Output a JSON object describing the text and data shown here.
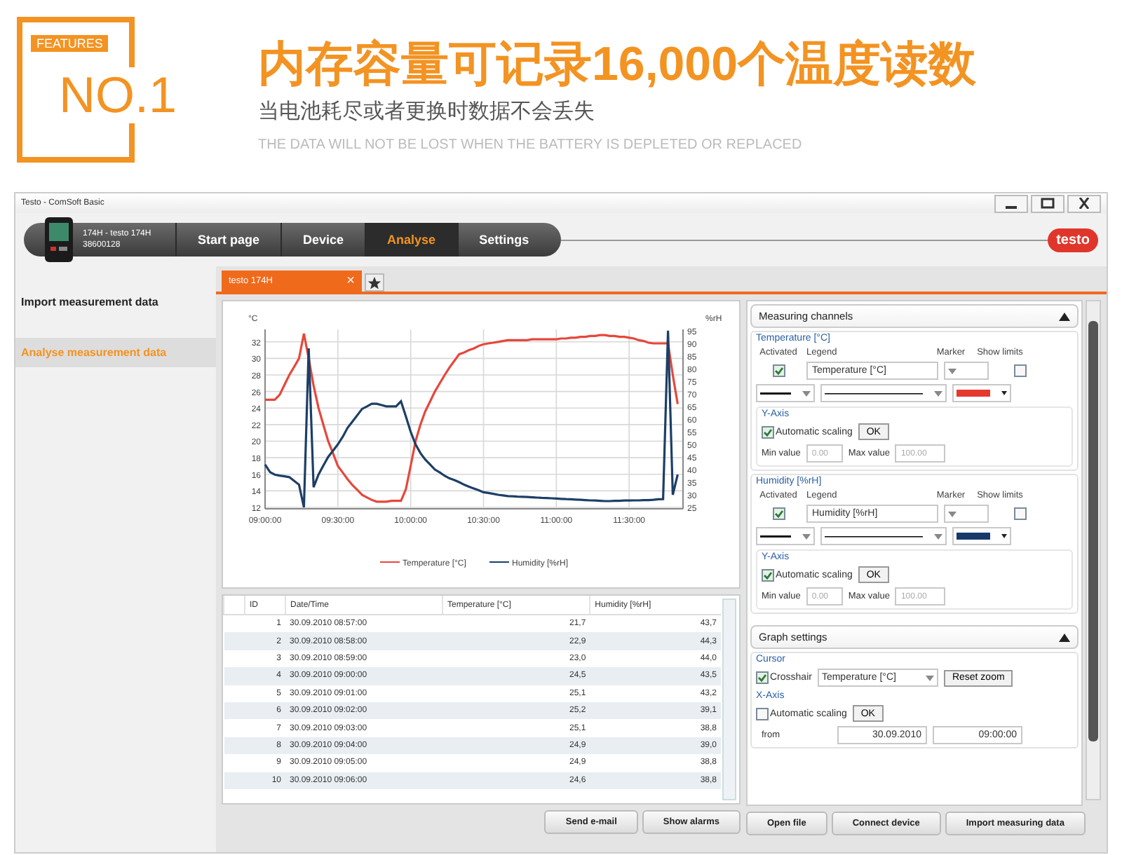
{
  "header": {
    "badge": "FEATURES",
    "rank": "NO.1",
    "title": "内存容量可记录16,000个温度读数",
    "subtitle": "当电池耗尽或者更换时数据不会丢失",
    "caption": "THE DATA WILL NOT BE LOST WHEN THE BATTERY IS DEPLETED OR REPLACED"
  },
  "window": {
    "title": "Testo - ComSoft Basic"
  },
  "device": {
    "name": "174H - testo 174H",
    "serial": "38600128"
  },
  "nav_tabs": [
    {
      "label": "Start page",
      "selected": false
    },
    {
      "label": "Device",
      "selected": false
    },
    {
      "label": "Analyse",
      "selected": true
    },
    {
      "label": "Settings",
      "selected": false
    }
  ],
  "logo": "testo",
  "sidebar": {
    "items": [
      {
        "label": "Import measurement data",
        "selected": false
      },
      {
        "label": "Analyse measurement data",
        "selected": true
      }
    ]
  },
  "doc_tabs": [
    {
      "label": "testo 174H",
      "close": "×",
      "selected": true
    }
  ],
  "chart_data": {
    "type": "line",
    "ylabel": "°C",
    "y2label": "%rH",
    "categories": [
      "09:00:00",
      null,
      null,
      null,
      null,
      null,
      null,
      null,
      null,
      null,
      null,
      null,
      null,
      null,
      null,
      "09:30:00",
      null,
      null,
      null,
      null,
      null,
      null,
      null,
      null,
      null,
      null,
      null,
      null,
      null,
      null,
      "10:00:00",
      null,
      null,
      null,
      null,
      null,
      null,
      null,
      null,
      null,
      null,
      null,
      null,
      null,
      null,
      "10:30:00",
      null,
      null,
      null,
      null,
      null,
      null,
      null,
      null,
      null,
      null,
      null,
      null,
      null,
      null,
      "11:00:00",
      null,
      null,
      null,
      null,
      null,
      null,
      null,
      null,
      null,
      null,
      null,
      null,
      null,
      null,
      "11:30:00",
      null,
      null,
      null,
      null,
      null,
      null,
      null,
      null,
      null,
      null
    ],
    "ylim": [
      12,
      33.5
    ],
    "y2lim": [
      25,
      95.5
    ],
    "grid": true,
    "legend": "bottom",
    "yticks": [
      12,
      14,
      16,
      18,
      20,
      22,
      24,
      26,
      28,
      30,
      32
    ],
    "y2ticks": [
      25,
      30,
      35,
      40,
      45,
      50,
      55,
      60,
      65,
      70,
      75,
      80,
      85,
      90,
      95
    ],
    "series": [
      {
        "name": "Temperature [°C]",
        "color": "#e5483c",
        "values": [
          25,
          25,
          25,
          25.6,
          26.8,
          28,
          29,
          30,
          33,
          30,
          26.7,
          24,
          22,
          20,
          18.5,
          17,
          16.2,
          15.4,
          14.7,
          14.1,
          13.5,
          13.2,
          12.9,
          12.7,
          12.7,
          12.7,
          12.8,
          12.8,
          12.8,
          14.2,
          17,
          20,
          22,
          23.6,
          24.8,
          26,
          27,
          28,
          28.9,
          29.7,
          30.5,
          30.7,
          31,
          31.2,
          31.5,
          31.7,
          31.8,
          31.9,
          32,
          32.1,
          32.2,
          32.2,
          32.2,
          32.2,
          32.2,
          32.3,
          32.3,
          32.3,
          32.3,
          32.3,
          32.3,
          32.4,
          32.4,
          32.5,
          32.5,
          32.6,
          32.6,
          32.7,
          32.7,
          32.8,
          32.8,
          32.7,
          32.7,
          32.6,
          32.6,
          32.5,
          32.4,
          32.2,
          32.1,
          31.9,
          31.8,
          31.8,
          31.8,
          31.8,
          28,
          24.5
        ]
      },
      {
        "name": "Humidity [%rH]",
        "color": "#1d3f66",
        "axis": "y2",
        "values": [
          42,
          39,
          38,
          37.6,
          37.3,
          37,
          35.5,
          34,
          25,
          88,
          33,
          38,
          41.5,
          45,
          47.5,
          50,
          53,
          56.5,
          59,
          61.5,
          64,
          65,
          66,
          66,
          65.5,
          65,
          65,
          65,
          67,
          61,
          55,
          50,
          46.5,
          44,
          42,
          40,
          38.8,
          37.5,
          36.5,
          35.8,
          35,
          34,
          33.2,
          32.5,
          31.8,
          31,
          30.7,
          30.4,
          30,
          29.8,
          29.5,
          29.4,
          29.3,
          29.2,
          29.1,
          29,
          28.9,
          28.8,
          28.7,
          28.6,
          28.5,
          28.4,
          28.3,
          28.2,
          28.1,
          28,
          27.9,
          27.8,
          27.7,
          27.6,
          27.5,
          27.5,
          27.6,
          27.6,
          27.7,
          27.7,
          27.8,
          27.8,
          27.9,
          27.9,
          28,
          28.2,
          28.3,
          95,
          30,
          38
        ]
      }
    ]
  },
  "table": {
    "columns": [
      "ID",
      "Date/Time",
      "Temperature [°C]",
      "Humidity [%rH]"
    ],
    "rows": [
      [
        "1",
        "30.09.2010 08:57:00",
        "21,7",
        "43,7"
      ],
      [
        "2",
        "30.09.2010 08:58:00",
        "22,9",
        "44,3"
      ],
      [
        "3",
        "30.09.2010 08:59:00",
        "23,0",
        "44,0"
      ],
      [
        "4",
        "30.09.2010 09:00:00",
        "24,5",
        "43,5"
      ],
      [
        "5",
        "30.09.2010 09:01:00",
        "25,1",
        "43,2"
      ],
      [
        "6",
        "30.09.2010 09:02:00",
        "25,2",
        "39,1"
      ],
      [
        "7",
        "30.09.2010 09:03:00",
        "25,1",
        "38,8"
      ],
      [
        "8",
        "30.09.2010 09:04:00",
        "24,9",
        "39,0"
      ],
      [
        "9",
        "30.09.2010 09:05:00",
        "24,9",
        "38,8"
      ],
      [
        "10",
        "30.09.2010 09:06:00",
        "24,6",
        "38,8"
      ]
    ]
  },
  "left_buttons": [
    "Send e-mail",
    "Show alarms"
  ],
  "right_buttons": [
    "Open file",
    "Connect device",
    "Import measuring data"
  ],
  "measuring_channels": {
    "title": "Measuring channels",
    "channels": [
      {
        "name": "Temperature [°C]",
        "column_labels": [
          "Activated",
          "Legend",
          "Marker",
          "Show limits"
        ],
        "activated": true,
        "legend": "Temperature [°C]",
        "show_limits": false,
        "color": "#e5392e",
        "y_axis": {
          "title": "Y-Axis",
          "auto_label": "Automatic scaling",
          "automatic_scaling": true,
          "ok": "OK",
          "min_label": "Min value",
          "min": "0.00",
          "max_label": "Max value",
          "max": "100.00"
        }
      },
      {
        "name": "Humidity [%rH]",
        "column_labels": [
          "Activated",
          "Legend",
          "Marker",
          "Show limits"
        ],
        "activated": true,
        "legend": "Humidity [%rH]",
        "show_limits": false,
        "color": "#173a6b",
        "y_axis": {
          "title": "Y-Axis",
          "auto_label": "Automatic scaling",
          "automatic_scaling": true,
          "ok": "OK",
          "min_label": "Min value",
          "min": "0.00",
          "max_label": "Max value",
          "max": "100.00"
        }
      }
    ]
  },
  "graph_settings": {
    "title": "Graph settings",
    "cursor": {
      "title": "Cursor",
      "crosshair_label": "Crosshair",
      "crosshair": true,
      "channel": "Temperature [°C]",
      "reset": "Reset zoom"
    },
    "x_axis": {
      "title": "X-Axis",
      "auto_label": "Automatic scaling",
      "automatic_scaling": false,
      "ok": "OK",
      "from_label": "from",
      "from_date": "30.09.2010",
      "from_time": "09:00:00"
    }
  }
}
